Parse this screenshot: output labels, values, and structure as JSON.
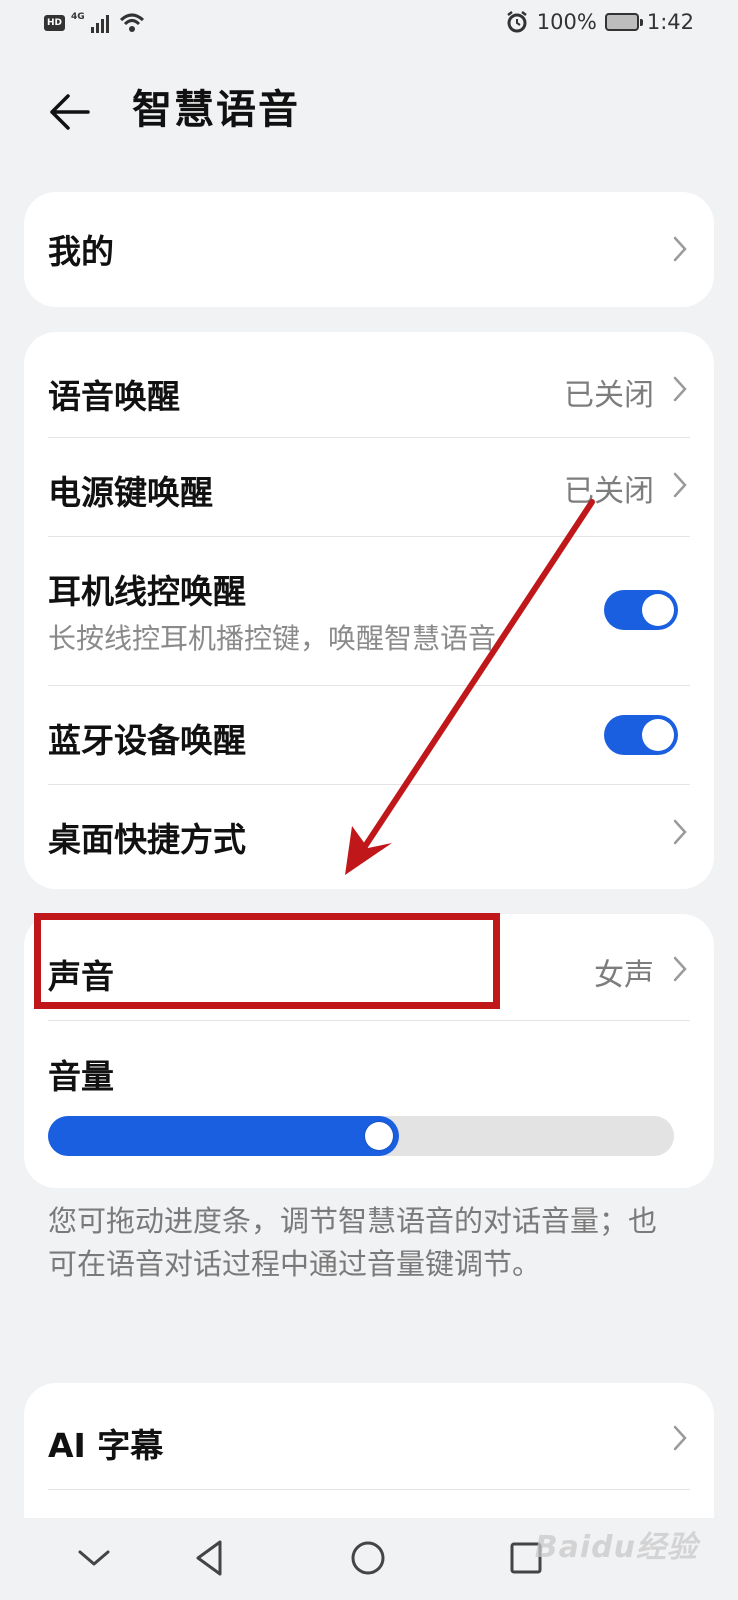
{
  "status_bar": {
    "hd": "HD",
    "network": "4G",
    "battery_percent": "100%",
    "time": "1:42",
    "icons": [
      "signal-icon",
      "wifi-icon",
      "alarm-icon",
      "battery-icon"
    ]
  },
  "header": {
    "title": "智慧语音",
    "back_icon": "arrow-left-icon"
  },
  "card_mine": {
    "label": "我的"
  },
  "card_wake": {
    "rows": [
      {
        "label": "语音唤醒",
        "value": "已关闭"
      },
      {
        "label": "电源键唤醒",
        "value": "已关闭"
      },
      {
        "label": "耳机线控唤醒",
        "subtitle": "长按线控耳机播控键，唤醒智慧语音",
        "toggle_on": true
      },
      {
        "label": "蓝牙设备唤醒",
        "toggle_on": true
      },
      {
        "label": "桌面快捷方式"
      }
    ]
  },
  "card_sound": {
    "voice_label": "声音",
    "voice_value": "女声",
    "volume_label": "音量",
    "volume_level": 0.56
  },
  "note": "您可拖动进度条，调节智慧语音的对话音量；也可在语音对话过程中通过音量键调节。",
  "card_ai": {
    "label": "AI 字幕"
  },
  "nav_bar": {
    "icons": [
      "chevron-down-icon",
      "back-triangle-icon",
      "home-circle-icon",
      "recents-square-icon"
    ]
  },
  "watermark": "Baidu经验",
  "colors": {
    "accent": "#1a5fe0",
    "annotation": "#c0171a",
    "background": "#f1f2f4"
  }
}
